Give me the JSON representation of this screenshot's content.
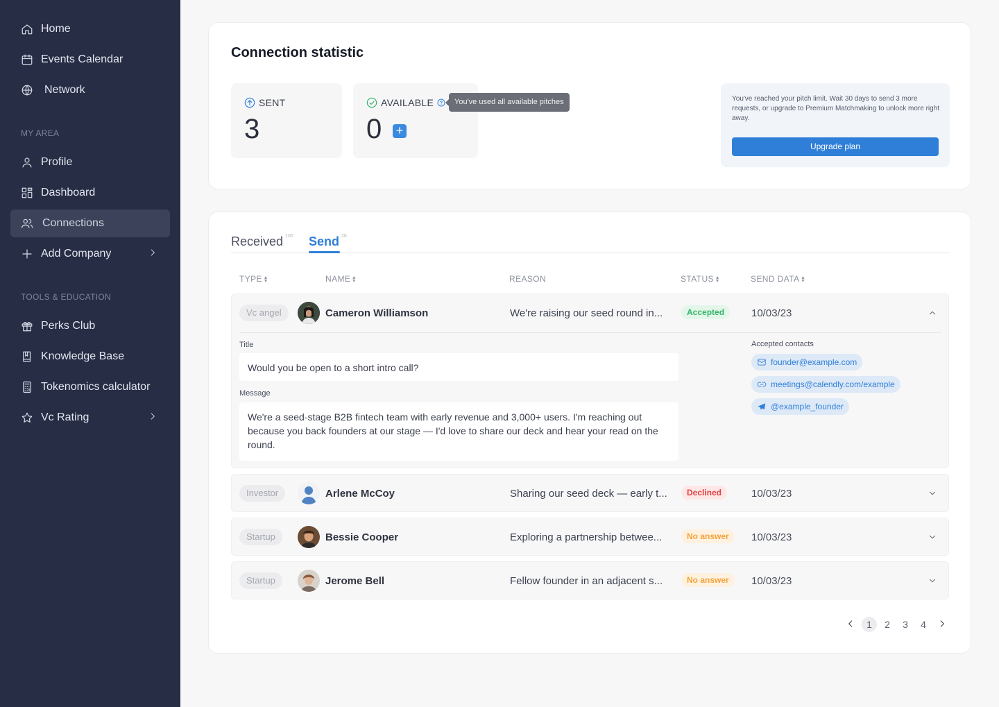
{
  "sidebar": {
    "main": [
      {
        "label": "Home",
        "icon": "home-icon"
      },
      {
        "label": "Events Calendar",
        "icon": "calendar-icon"
      },
      {
        "label": "Network",
        "icon": "globe-icon"
      }
    ],
    "my_area_label": "MY AREA",
    "my_area": [
      {
        "label": "Profile",
        "icon": "user-icon"
      },
      {
        "label": "Dashboard",
        "icon": "dashboard-icon"
      },
      {
        "label": "Connections",
        "icon": "users-icon"
      },
      {
        "label": "Add Company",
        "icon": "plus-icon"
      }
    ],
    "tools_label": "TOOLS & EDUCATION",
    "tools": [
      {
        "label": "Perks Club",
        "icon": "gift-icon"
      },
      {
        "label": "Knowledge Base",
        "icon": "book-icon"
      },
      {
        "label": "Tokenomics calculator",
        "icon": "calculator-icon"
      },
      {
        "label": "Vc Rating",
        "icon": "star-icon"
      }
    ]
  },
  "stats": {
    "title": "Connection statistic",
    "sent_label": "SENT",
    "sent_value": "3",
    "available_label": "AVAILABLE",
    "available_value": "0",
    "tooltip": "You've used all available pitches",
    "limit_text": "You've reached your pitch limit. Wait 30 days to send 3 more requests, or upgrade to Premium Matchmaking to unlock more right away.",
    "upgrade_label": "Upgrade plan",
    "colors": {
      "accent": "#2f7fd8",
      "sidebar": "#272d45"
    }
  },
  "tabs": {
    "received_label": "Received",
    "received_count": "100",
    "send_label": "Send",
    "send_count": "26"
  },
  "columns": {
    "type": "TYPE",
    "name": "NAME",
    "reason": "REASON",
    "status": "STATUS",
    "send_data": "SEND DATA"
  },
  "rows": [
    {
      "type": "Vc angel",
      "name": "Cameron Williamson",
      "reason": "We're raising our seed round in...",
      "status": "Accepted",
      "date": "10/03/23"
    },
    {
      "type": "Investor",
      "name": "Arlene McCoy",
      "reason": "Sharing our seed deck — early t...",
      "status": "Declined",
      "date": "10/03/23"
    },
    {
      "type": "Startup",
      "name": "Bessie Cooper",
      "reason": "Exploring a partnership betwee...",
      "status": "No answer",
      "date": "10/03/23"
    },
    {
      "type": "Startup",
      "name": "Jerome Bell",
      "reason": "Fellow founder in an adjacent s...",
      "status": "No answer",
      "date": "10/03/23"
    }
  ],
  "expanded": {
    "title_label": "Title",
    "title_value": "Would you be open to a short intro call?",
    "message_label": "Message",
    "message_value": "We're a seed-stage B2B fintech team with early revenue and 3,000+ users. I'm reaching out because you back founders at our stage — I'd love to share our deck and hear your read on the round.",
    "contacts_label": "Accepted contacts",
    "contacts": [
      {
        "value": "founder@example.com",
        "icon": "mail-icon"
      },
      {
        "value": "meetings@calendly.com/example",
        "icon": "link-icon"
      },
      {
        "value": "@example_founder",
        "icon": "telegram-icon"
      }
    ]
  },
  "pagination": {
    "pages": [
      "1",
      "2",
      "3",
      "4"
    ],
    "current": "1"
  }
}
